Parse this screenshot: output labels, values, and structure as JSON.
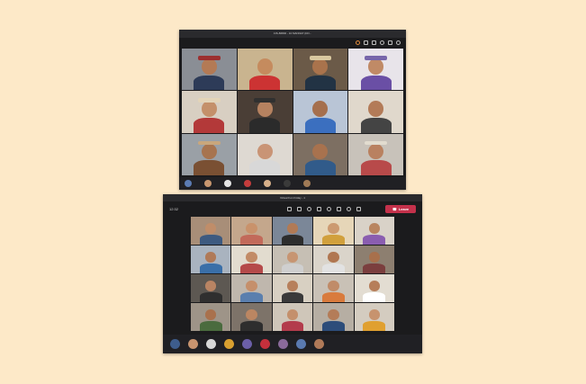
{
  "window1": {
    "title": "CIS-86800 - 10 MANNAT (DO...",
    "tiles": [
      {
        "name": "",
        "bg": "#8a8e95",
        "skin": "#b37a55",
        "shirt": "#2d3b58",
        "hat": "#9c2f2f"
      },
      {
        "name": "",
        "bg": "#c9b48f",
        "skin": "#c58b5e",
        "shirt": "#cc3333",
        "hat": ""
      },
      {
        "name": "",
        "bg": "#6b5a48",
        "skin": "#a9734c",
        "shirt": "#223344",
        "hat": "#d9c8a0"
      },
      {
        "name": "",
        "bg": "#e8e4ea",
        "skin": "#c08a66",
        "shirt": "#6a4fa5",
        "hat": "#7766aa"
      },
      {
        "name": "",
        "bg": "#d8cfc2",
        "skin": "#c4906a",
        "shirt": "#b33939",
        "hat": "#e3d4b8"
      },
      {
        "name": "",
        "bg": "#4a3e36",
        "skin": "#b68260",
        "shirt": "#2b2b2b",
        "hat": "#303030"
      },
      {
        "name": "",
        "bg": "#b9c5d6",
        "skin": "#a56f4d",
        "shirt": "#3b6fbf",
        "hat": ""
      },
      {
        "name": "",
        "bg": "#e0d8cc",
        "skin": "#b37b58",
        "shirt": "#444444",
        "hat": ""
      },
      {
        "name": "",
        "bg": "#9aa0a6",
        "skin": "#a7744f",
        "shirt": "#7a5033",
        "hat": "#c9a77c"
      },
      {
        "name": "",
        "bg": "#ded9d2",
        "skin": "#c99475",
        "shirt": "#d8d8d8",
        "hat": ""
      },
      {
        "name": "",
        "bg": "#7d6f62",
        "skin": "#a8724e",
        "shirt": "#315b8a",
        "hat": ""
      },
      {
        "name": "",
        "bg": "#c8c2ba",
        "skin": "#b98160",
        "shirt": "#b84a4a",
        "hat": "#e2dccf"
      }
    ],
    "strip": [
      "#5b7bb3",
      "#c9976f",
      "#e5e5e5",
      "#c43c3c",
      "#d7b08a",
      "#3a3a3a",
      "#a07a56"
    ]
  },
  "window2": {
    "title": "Virtual Fun Friday - 1",
    "time": "12:32",
    "leave_label": "Leave",
    "tiles": [
      {
        "name": "",
        "bg": "#a88e78",
        "skin": "#c08d69",
        "shirt": "#3d5a80",
        "hat": ""
      },
      {
        "name": "",
        "bg": "#c4a78c",
        "skin": "#c9926b",
        "shirt": "#c26a5a",
        "hat": ""
      },
      {
        "name": "",
        "bg": "#7b8798",
        "skin": "#b17a55",
        "shirt": "#2d2d2d",
        "hat": ""
      },
      {
        "name": "",
        "bg": "#e6d6b8",
        "skin": "#cc9a70",
        "shirt": "#d1a03c",
        "hat": ""
      },
      {
        "name": "",
        "bg": "#d9d2c8",
        "skin": "#b98560",
        "shirt": "#8a5db0",
        "hat": ""
      },
      {
        "name": "",
        "bg": "#a9b3bf",
        "skin": "#b07a58",
        "shirt": "#3a6fa8",
        "hat": ""
      },
      {
        "name": "",
        "bg": "#e2dccf",
        "skin": "#c28b66",
        "shirt": "#b54a4a",
        "hat": ""
      },
      {
        "name": "",
        "bg": "#c6bfb4",
        "skin": "#c79572",
        "shirt": "#cfcfcf",
        "hat": ""
      },
      {
        "name": "",
        "bg": "#dad4ca",
        "skin": "#b07650",
        "shirt": "#e2e2e2",
        "hat": ""
      },
      {
        "name": "",
        "bg": "#8d7f70",
        "skin": "#a8704c",
        "shirt": "#7b3e3e",
        "hat": ""
      },
      {
        "name": "",
        "bg": "#5d5852",
        "skin": "#b98463",
        "shirt": "#2f2f2f",
        "hat": ""
      },
      {
        "name": "",
        "bg": "#bfb7ad",
        "skin": "#c58f6b",
        "shirt": "#5a7fae",
        "hat": ""
      },
      {
        "name": "",
        "bg": "#d8d0c2",
        "skin": "#b7805c",
        "shirt": "#3a3a3a",
        "hat": ""
      },
      {
        "name": "",
        "bg": "#c9c1b6",
        "skin": "#c08b68",
        "shirt": "#d97b3d",
        "hat": ""
      },
      {
        "name": "",
        "bg": "#e3ddd2",
        "skin": "#b67e5a",
        "shirt": "#ffffff",
        "hat": ""
      },
      {
        "name": "",
        "bg": "#9e9488",
        "skin": "#a9714d",
        "shirt": "#4a6b3e",
        "hat": ""
      },
      {
        "name": "",
        "bg": "#7d7369",
        "skin": "#bb8662",
        "shirt": "#2e2e2e",
        "hat": ""
      },
      {
        "name": "",
        "bg": "#cfc6b9",
        "skin": "#c4906c",
        "shirt": "#b33c4c",
        "hat": ""
      },
      {
        "name": "",
        "bg": "#b6aea3",
        "skin": "#b47c58",
        "shirt": "#2d4d7a",
        "hat": ""
      },
      {
        "name": "",
        "bg": "#d4ccc0",
        "skin": "#c7936e",
        "shirt": "#e0a030",
        "hat": ""
      },
      {
        "name": "",
        "bg": "#c0b6a8",
        "skin": "#b9845f",
        "shirt": "#8a8a8a",
        "hat": ""
      }
    ],
    "strip": [
      "#3e5d8c",
      "#c8946f",
      "#d8d8d8",
      "#d9a030",
      "#6b5fa8",
      "#c4303c",
      "#8a6a9a",
      "#5a7ab0",
      "#b07a58"
    ]
  },
  "colors": {
    "page_bg": "#fde9c8",
    "window_bg": "#1b1b1d",
    "leave": "#c4314b"
  }
}
